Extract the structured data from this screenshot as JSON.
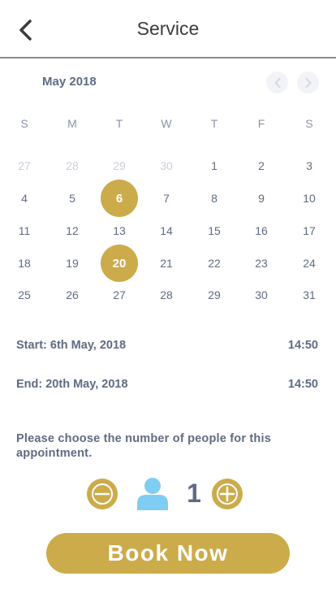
{
  "header": {
    "title": "Service"
  },
  "calendar": {
    "month_label": "May 2018",
    "weekdays": [
      "S",
      "M",
      "T",
      "W",
      "T",
      "F",
      "S"
    ],
    "weeks": [
      [
        {
          "d": "27",
          "muted": true
        },
        {
          "d": "28",
          "muted": true
        },
        {
          "d": "29",
          "muted": true
        },
        {
          "d": "30",
          "muted": true
        },
        {
          "d": "1"
        },
        {
          "d": "2"
        },
        {
          "d": "3"
        }
      ],
      [
        {
          "d": "4"
        },
        {
          "d": "5"
        },
        {
          "d": "6",
          "selected": true
        },
        {
          "d": "7"
        },
        {
          "d": "8"
        },
        {
          "d": "9"
        },
        {
          "d": "10"
        }
      ],
      [
        {
          "d": "11"
        },
        {
          "d": "12"
        },
        {
          "d": "13"
        },
        {
          "d": "14"
        },
        {
          "d": "15"
        },
        {
          "d": "16"
        },
        {
          "d": "17"
        }
      ],
      [
        {
          "d": "18"
        },
        {
          "d": "19"
        },
        {
          "d": "20",
          "selected": true
        },
        {
          "d": "21"
        },
        {
          "d": "22"
        },
        {
          "d": "23"
        },
        {
          "d": "24"
        }
      ],
      [
        {
          "d": "25"
        },
        {
          "d": "26"
        },
        {
          "d": "27"
        },
        {
          "d": "28"
        },
        {
          "d": "29"
        },
        {
          "d": "30"
        },
        {
          "d": "31"
        }
      ]
    ]
  },
  "booking": {
    "start_label": "Start: 6th May, 2018",
    "start_time": "14:50",
    "end_label": "End: 20th May, 2018",
    "end_time": "14:50"
  },
  "people": {
    "prompt": "Please choose the number of people for this appointment.",
    "count": "1",
    "minus_icon": "minus-circle-icon",
    "plus_icon": "plus-circle-icon",
    "person_icon": "person-icon"
  },
  "actions": {
    "book_label": "Book Now"
  },
  "colors": {
    "accent": "#ccab4b",
    "text": "#5f6b83",
    "muted": "#c9ced8",
    "person": "#7fcdf2"
  }
}
